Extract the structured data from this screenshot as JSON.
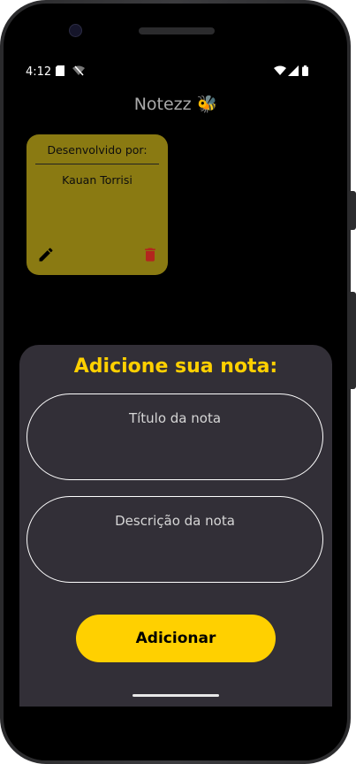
{
  "status_bar": {
    "time": "4:12",
    "icons": [
      "sd-card-icon",
      "wifi-off-icon",
      "wifi-icon",
      "cell-signal-icon",
      "battery-icon"
    ]
  },
  "app": {
    "title": "Notezz 🐝"
  },
  "note_card": {
    "heading": "Desenvolvido por:",
    "name": "Kauan Torrisi",
    "color": "#8a7a12",
    "edit_icon": "pencil-icon",
    "delete_icon": "trash-icon",
    "delete_color": "#b3261e"
  },
  "sheet": {
    "title": "Adicione sua nota:",
    "title_color": "#ffd000",
    "background": "#322f37",
    "title_input_placeholder": "Título da nota",
    "description_input_placeholder": "Descrição da nota",
    "add_button_label": "Adicionar",
    "button_color": "#ffd000"
  }
}
